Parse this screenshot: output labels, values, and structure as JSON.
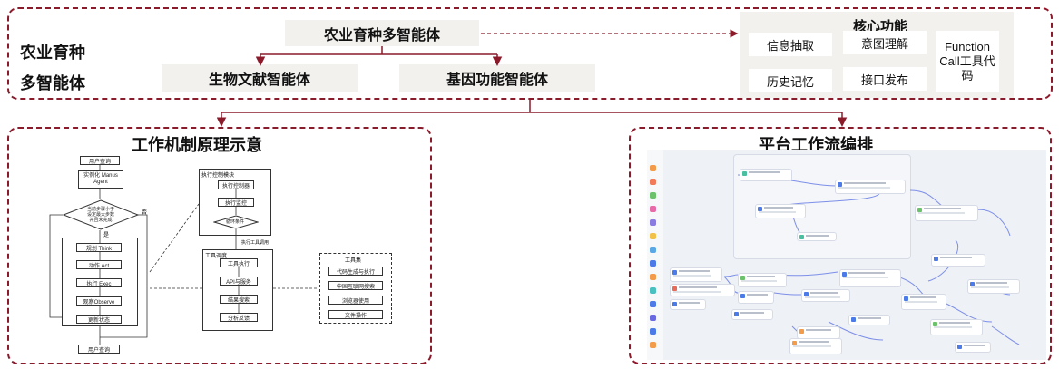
{
  "top": {
    "title_line1": "农业育种",
    "title_line2": "多智能体",
    "center_node": "农业育种多智能体",
    "child_left": "生物文献智能体",
    "child_right": "基因功能智能体",
    "core": {
      "title": "核心功能",
      "items": [
        "信息抽取",
        "意图理解",
        "历史记忆",
        "接口发布"
      ],
      "function_call": "Function Call工具代码"
    }
  },
  "left_panel": {
    "title": "工作机制原理示意",
    "mech": {
      "user_query_top": "用户查询",
      "instantiate": "实例化 Manus Agent",
      "decision": "当前步骤小于设定最大步数并且未完成",
      "no": "否",
      "yes": "是",
      "think": "规划 Think",
      "act": "动作 Act",
      "exec": "执行 Exec",
      "observe": "观察Observe",
      "update": "更新状态",
      "user_query_bottom": "用户查询",
      "exec_module_title": "执行控制模块",
      "exec_controller": "执行控制器",
      "exec_monitor": "执行监控",
      "loop_check": "循环条件",
      "tool_call_label": "执行工具调用",
      "tool_call_title": "工具调度",
      "tool_exec": "工具执行",
      "api_service": "API与服务",
      "result_search": "结果搜索",
      "analysis_feedback": "分析反馈",
      "toolset_title": "工具集",
      "tools": [
        "代码生成与执行",
        "中国互联网搜索",
        "浏览器使用",
        "文件操作"
      ]
    }
  },
  "right_panel": {
    "title": "平台工作流编排"
  },
  "colors": {
    "accent": "#8b1a2b",
    "grey_box": "#f2f1ee",
    "workflow_bg": "#eef1f6"
  },
  "icons": [
    "flow-arrow-icon",
    "workflow-node-icon"
  ]
}
